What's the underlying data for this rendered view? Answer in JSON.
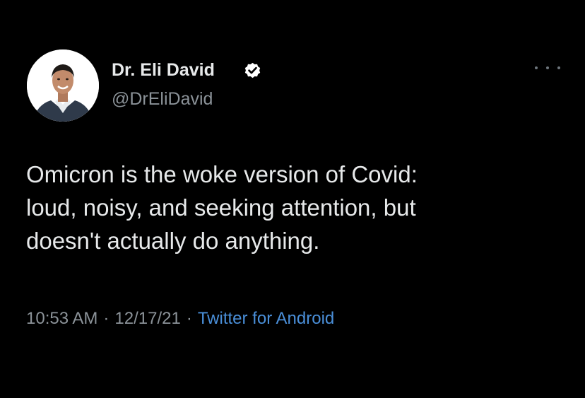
{
  "tweet": {
    "author": {
      "display_name": "Dr. Eli David",
      "handle": "@DrEliDavid",
      "verified": true,
      "verified_color": "#ffffff"
    },
    "text_lines": [
      "Omicron is the woke version of Covid:",
      "loud, noisy, and seeking attention, but",
      "doesn't actually do anything."
    ],
    "time": "10:53 AM",
    "separator": "·",
    "date": "12/17/21",
    "source": "Twitter for Android"
  },
  "colors": {
    "background": "#000000",
    "primary_text": "#e7e9ea",
    "secondary_text": "#8b9298",
    "link": "#4a8fd9"
  },
  "icons": {
    "more": "more-horizontal-icon",
    "verified": "verified-badge-icon"
  }
}
